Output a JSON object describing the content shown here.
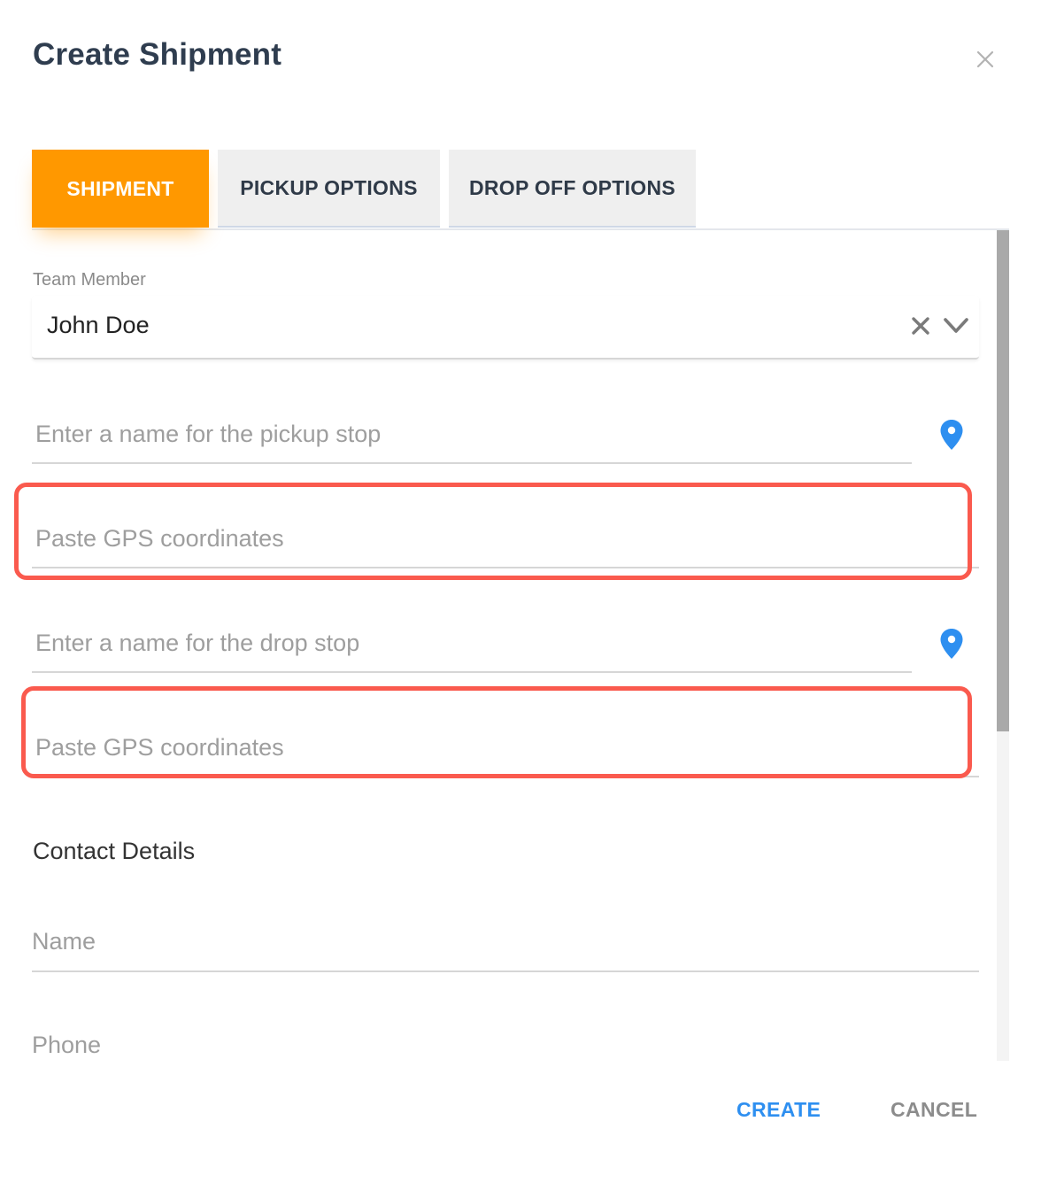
{
  "dialog": {
    "title": "Create Shipment"
  },
  "tabs": [
    {
      "label": "SHIPMENT",
      "active": true
    },
    {
      "label": "PICKUP OPTIONS",
      "active": false
    },
    {
      "label": "DROP OFF OPTIONS",
      "active": false
    }
  ],
  "team_member": {
    "label": "Team Member",
    "value": "John Doe"
  },
  "pickup": {
    "name_placeholder": "Enter a name for the pickup stop",
    "gps_placeholder": "Paste GPS coordinates"
  },
  "drop": {
    "name_placeholder": "Enter a name for the drop stop",
    "gps_placeholder": "Paste GPS coordinates"
  },
  "contact": {
    "section_title": "Contact Details",
    "name_placeholder": "Name",
    "phone_placeholder": "Phone"
  },
  "actions": {
    "create_label": "CREATE",
    "cancel_label": "CANCEL"
  },
  "colors": {
    "active_tab": "#ff9800",
    "primary": "#2e8ff0",
    "highlight": "#fa5a4e",
    "pin": "#2e8ff0"
  },
  "icons": [
    "close-icon",
    "clear-icon",
    "chevron-down-icon",
    "map-pin-icon"
  ]
}
